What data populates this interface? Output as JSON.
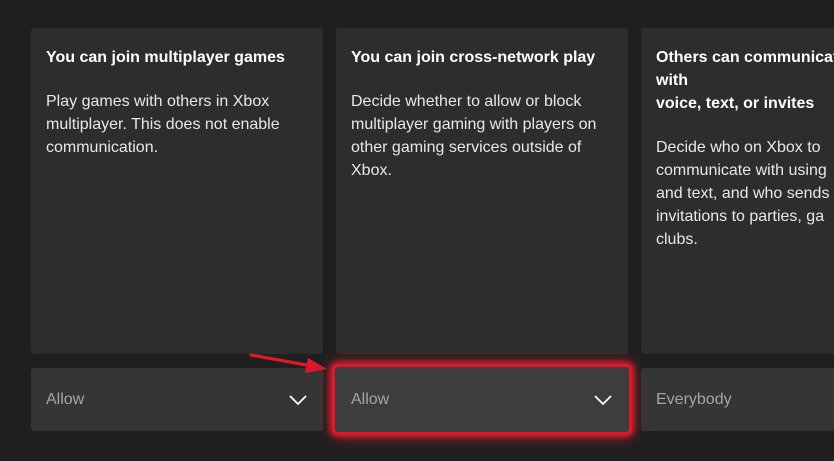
{
  "cards": [
    {
      "title": "You can join multiplayer games",
      "description": "Play games with others in Xbox multiplayer. This does not enable communication.",
      "dropdown_value": "Allow"
    },
    {
      "title": "You can join cross-network play",
      "description": "Decide whether to allow or block multiplayer gaming with players on other gaming services outside of Xbox.",
      "dropdown_value": "Allow"
    },
    {
      "title": "Others can communicate with\nvoice, text, or invites",
      "description": "Decide who on Xbox to\ncommunicate with using\nand text, and who sends\ninvitations to parties, ga\nclubs.",
      "dropdown_value": "Everybody"
    }
  ],
  "icons": {
    "dropdown": "chevron-down-icon",
    "annotation": "red-arrow-icon"
  },
  "colors": {
    "background": "#1f1f1f",
    "card": "#2d2d2d",
    "dropdown": "#353535",
    "highlight": "#e0162b"
  }
}
